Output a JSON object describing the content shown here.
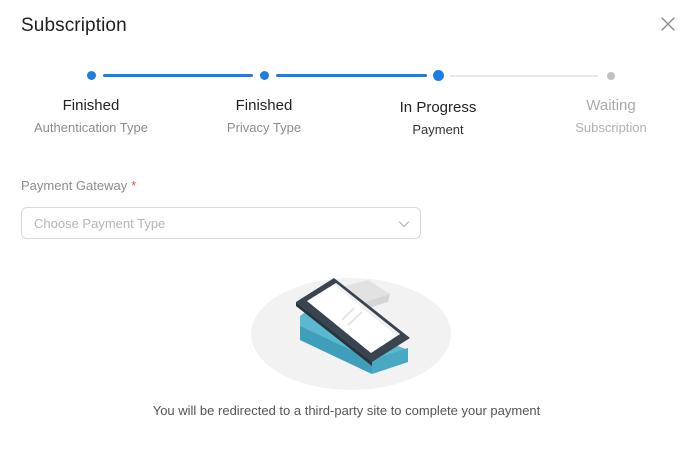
{
  "dialog": {
    "title": "Subscription",
    "close_icon": "close-icon"
  },
  "steps": [
    {
      "status": "Finished",
      "name": "Authentication Type",
      "state": "finished"
    },
    {
      "status": "Finished",
      "name": "Privacy Type",
      "state": "finished"
    },
    {
      "status": "In Progress",
      "name": "Payment",
      "state": "in-progress"
    },
    {
      "status": "Waiting",
      "name": "Subscription",
      "state": "waiting"
    }
  ],
  "form": {
    "gateway_label": "Payment Gateway",
    "required_mark": "*",
    "gateway_placeholder": "Choose Payment Type",
    "dropdown_icon": "chevron-down-icon"
  },
  "illustration": {
    "icon": "payment-terminal-icon"
  },
  "message": "You will be redirected to a third-party site to complete your payment",
  "colors": {
    "accent": "#1e7ce8",
    "waiting": "#bfbfbf",
    "required": "#e0554b",
    "terminal_teal": "#5ab8cf",
    "terminal_dark": "#3a4450"
  }
}
